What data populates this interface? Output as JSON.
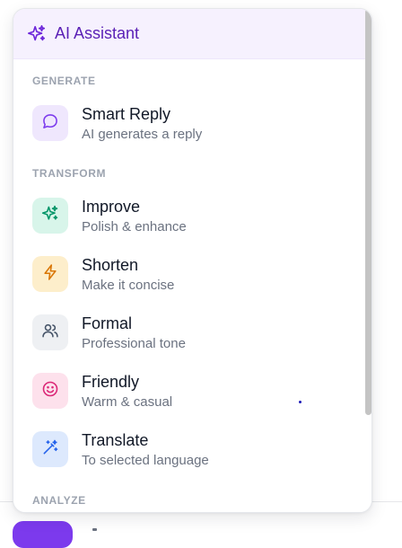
{
  "header": {
    "title": "AI Assistant",
    "icon": "sparkles-icon",
    "accent": "#6d28d9"
  },
  "sections": [
    {
      "label": "GENERATE",
      "items": [
        {
          "title": "Smart Reply",
          "subtitle": "AI generates a reply",
          "icon": "chat-bubble-icon",
          "color": "#7c3aed",
          "bg": "#efe7fd"
        }
      ]
    },
    {
      "label": "TRANSFORM",
      "items": [
        {
          "title": "Improve",
          "subtitle": "Polish & enhance",
          "icon": "sparkles-icon",
          "color": "#059669",
          "bg": "#d8f5ea"
        },
        {
          "title": "Shorten",
          "subtitle": "Make it concise",
          "icon": "lightning-icon",
          "color": "#d97706",
          "bg": "#fdeecb"
        },
        {
          "title": "Formal",
          "subtitle": "Professional tone",
          "icon": "users-icon",
          "color": "#475569",
          "bg": "#eef0f3"
        },
        {
          "title": "Friendly",
          "subtitle": "Warm & casual",
          "icon": "smiley-icon",
          "color": "#db2777",
          "bg": "#fde1ec"
        },
        {
          "title": "Translate",
          "subtitle": "To selected language",
          "icon": "magic-wand-icon",
          "color": "#2563eb",
          "bg": "#dde9fd"
        }
      ]
    },
    {
      "label": "ANALYZE",
      "items": []
    }
  ]
}
